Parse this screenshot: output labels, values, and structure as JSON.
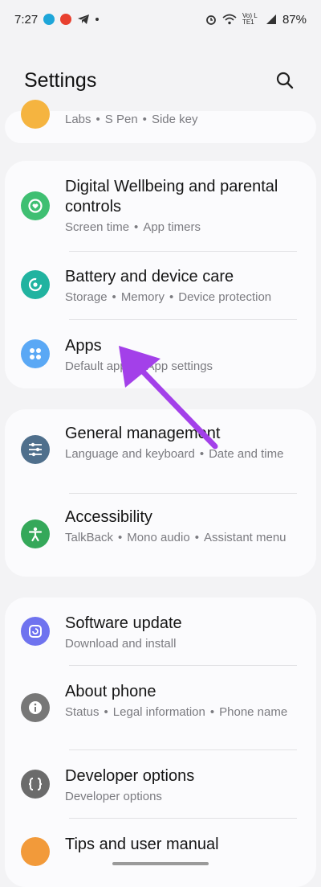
{
  "status_bar": {
    "time": "7:27",
    "battery": "87%",
    "network": "Vo) LTE1"
  },
  "header": {
    "title": "Settings"
  },
  "sections": {
    "top": {
      "subtitle": [
        "Labs",
        "S Pen",
        "Side key"
      ]
    },
    "digital_wellbeing": {
      "title": "Digital Wellbeing and parental controls",
      "subtitle": [
        "Screen time",
        "App timers"
      ]
    },
    "battery": {
      "title": "Battery and device care",
      "subtitle": [
        "Storage",
        "Memory",
        "Device protection"
      ]
    },
    "apps": {
      "title": "Apps",
      "subtitle": [
        "Default apps",
        "App settings"
      ]
    },
    "general": {
      "title": "General management",
      "subtitle": [
        "Language and keyboard",
        "Date and time"
      ]
    },
    "accessibility": {
      "title": "Accessibility",
      "subtitle": [
        "TalkBack",
        "Mono audio",
        "Assistant menu"
      ]
    },
    "software_update": {
      "title": "Software update",
      "subtitle": [
        "Download and install"
      ]
    },
    "about_phone": {
      "title": "About phone",
      "subtitle": [
        "Status",
        "Legal information",
        "Phone name"
      ]
    },
    "developer": {
      "title": "Developer options",
      "subtitle": [
        "Developer options"
      ]
    },
    "tips": {
      "title": "Tips and user manual"
    }
  },
  "colors": {
    "wellbeing": "#3fbf72",
    "battery": "#21b3a0",
    "apps": "#5aa8f5",
    "general": "#4f6f8c",
    "accessibility": "#35a85a",
    "software_update": "#6f73ef",
    "about_phone": "#777777",
    "developer": "#6b6b6b",
    "tips": "#f29a3a",
    "arrow": "#a340e9"
  }
}
